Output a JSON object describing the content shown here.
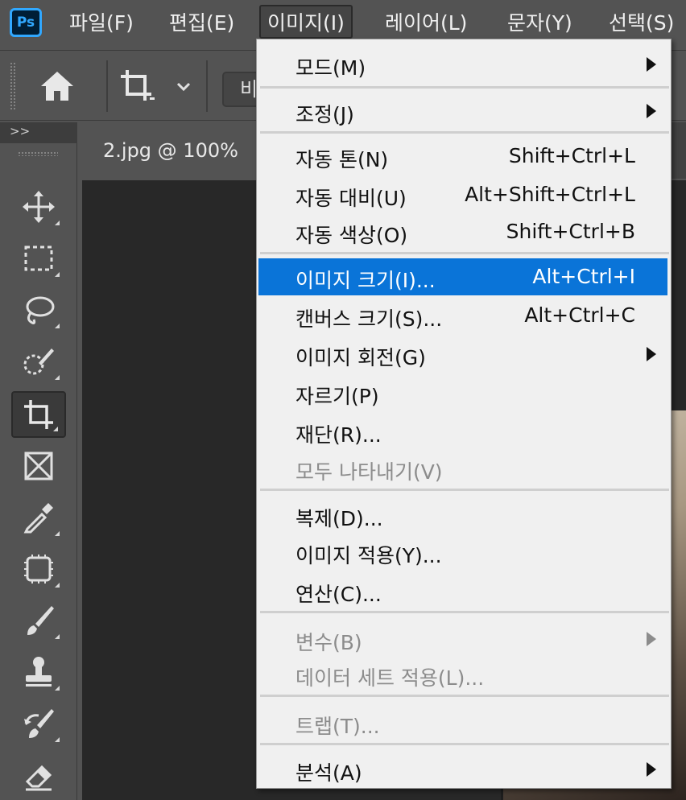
{
  "app": {
    "logo_text": "Ps"
  },
  "menubar": {
    "items": [
      {
        "label": "파일(F)"
      },
      {
        "label": "편집(E)"
      },
      {
        "label": "이미지(I)"
      },
      {
        "label": "레이어(L)"
      },
      {
        "label": "문자(Y)"
      },
      {
        "label": "선택(S)"
      }
    ],
    "active_index": 2
  },
  "options_bar": {
    "partial_text": "비"
  },
  "toolbar": {
    "expand_glyph": ">>"
  },
  "document": {
    "tab_title": "2.jpg @ 100%"
  },
  "image_menu": {
    "items": [
      {
        "label": "모드(M)",
        "shortcut": "",
        "submenu": true,
        "disabled": false
      },
      {
        "label": "조정(J)",
        "shortcut": "",
        "submenu": true,
        "disabled": false
      },
      {
        "label": "자동 톤(N)",
        "shortcut": "Shift+Ctrl+L",
        "submenu": false,
        "disabled": false
      },
      {
        "label": "자동 대비(U)",
        "shortcut": "Alt+Shift+Ctrl+L",
        "submenu": false,
        "disabled": false
      },
      {
        "label": "자동 색상(O)",
        "shortcut": "Shift+Ctrl+B",
        "submenu": false,
        "disabled": false
      },
      {
        "label": "이미지 크기(I)...",
        "shortcut": "Alt+Ctrl+I",
        "submenu": false,
        "disabled": false,
        "highlighted": true
      },
      {
        "label": "캔버스 크기(S)...",
        "shortcut": "Alt+Ctrl+C",
        "submenu": false,
        "disabled": false
      },
      {
        "label": "이미지 회전(G)",
        "shortcut": "",
        "submenu": true,
        "disabled": false
      },
      {
        "label": "자르기(P)",
        "shortcut": "",
        "submenu": false,
        "disabled": false
      },
      {
        "label": "재단(R)...",
        "shortcut": "",
        "submenu": false,
        "disabled": false
      },
      {
        "label": "모두 나타내기(V)",
        "shortcut": "",
        "submenu": false,
        "disabled": true
      },
      {
        "label": "복제(D)...",
        "shortcut": "",
        "submenu": false,
        "disabled": false
      },
      {
        "label": "이미지 적용(Y)...",
        "shortcut": "",
        "submenu": false,
        "disabled": false
      },
      {
        "label": "연산(C)...",
        "shortcut": "",
        "submenu": false,
        "disabled": false
      },
      {
        "label": "변수(B)",
        "shortcut": "",
        "submenu": true,
        "disabled": true
      },
      {
        "label": "데이터 세트 적용(L)...",
        "shortcut": "",
        "submenu": false,
        "disabled": true
      },
      {
        "label": "트랩(T)...",
        "shortcut": "",
        "submenu": false,
        "disabled": true
      },
      {
        "label": "분석(A)",
        "shortcut": "",
        "submenu": true,
        "disabled": false
      }
    ]
  },
  "colors": {
    "highlight": "#0a74d8",
    "menu_bg": "#f0f0f0",
    "chrome": "#535353",
    "ps_blue": "#31a8ff"
  }
}
